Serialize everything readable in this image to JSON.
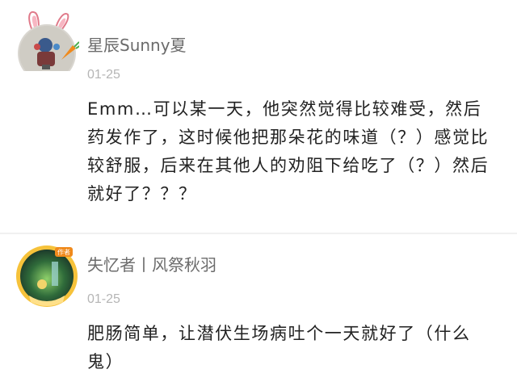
{
  "comments": [
    {
      "username": "星辰Sunny夏",
      "time": "01-25",
      "content": "Emm…可以某一天，他突然觉得比较难受，然后药发作了，这时候他把那朵花的味道（？）感觉比较舒服，后来在其他人的劝阻下给吃了（？）然后就好了？？？",
      "avatar_icon": "rabbit-ear-avatar-icon"
    },
    {
      "username": "失忆者丨风祭秋羽",
      "time": "01-25",
      "content": "肥肠简单，让潜伏生场病吐个一天就好了（什么鬼）",
      "avatar_icon": "game-scene-avatar-icon"
    }
  ],
  "colors": {
    "username": "#6b6b6b",
    "time": "#b5b5b5",
    "content": "#222222",
    "accent_orange": "#f08a1c"
  }
}
